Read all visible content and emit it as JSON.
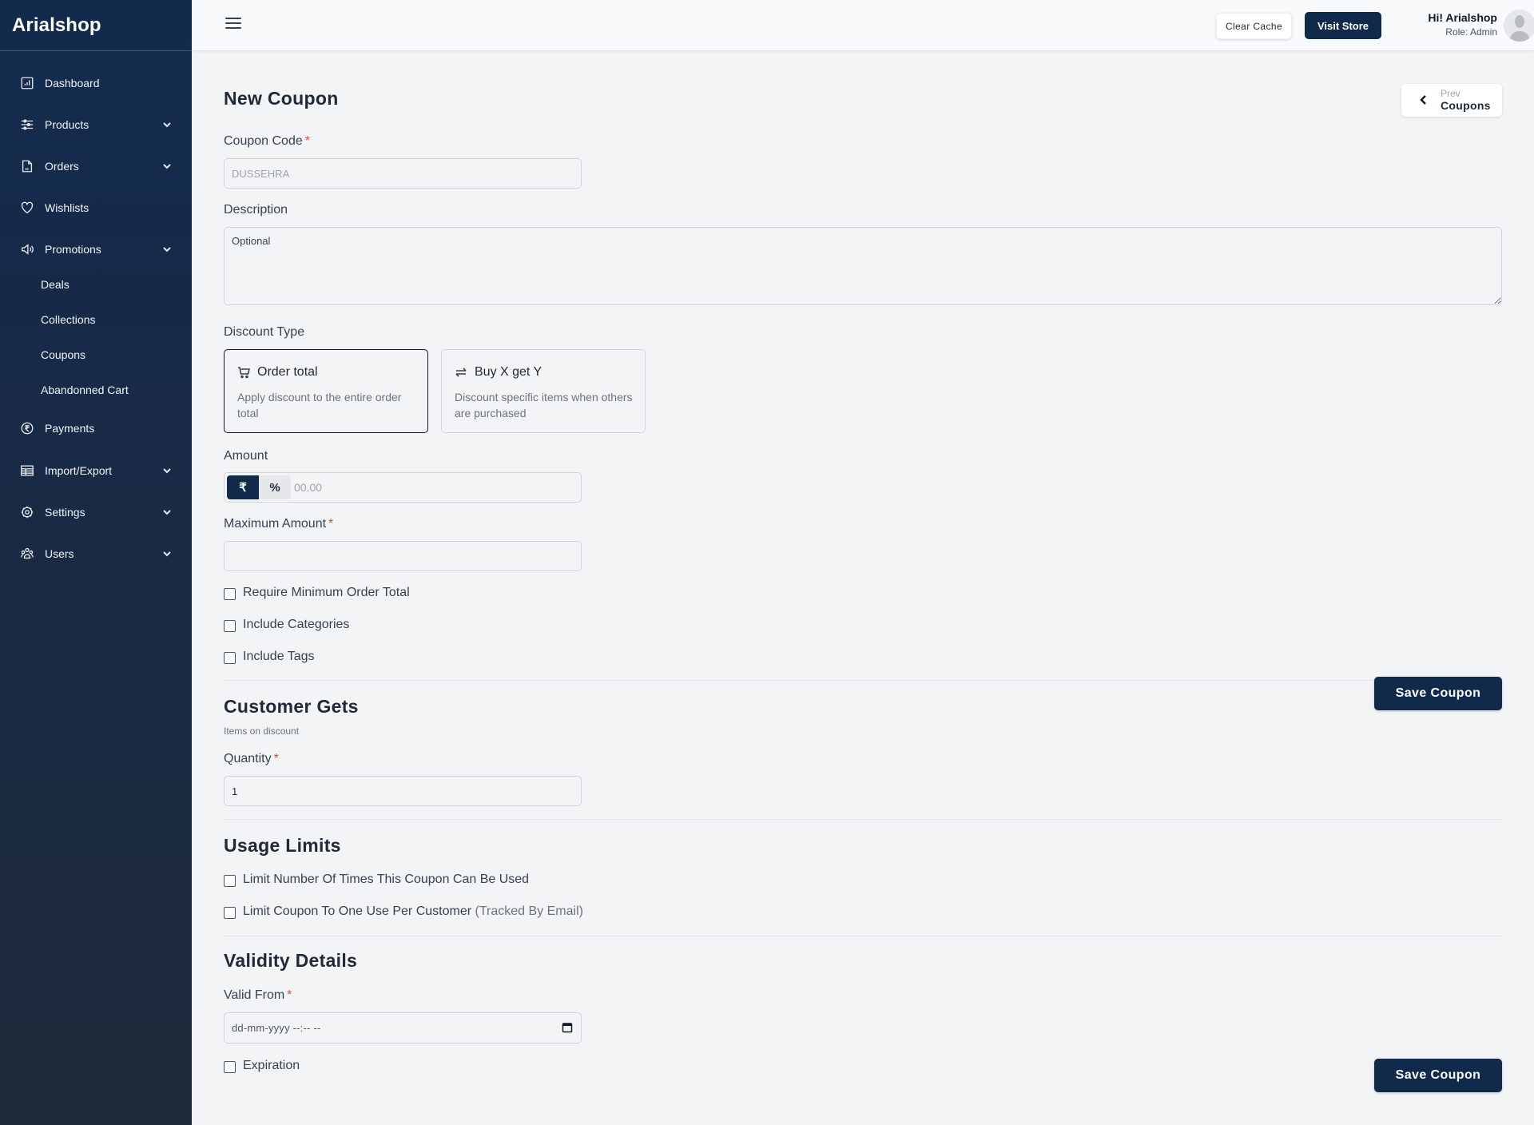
{
  "app": {
    "brand": "Arialshop"
  },
  "sidebar": {
    "items": [
      {
        "label": "Dashboard",
        "icon": "dashboard-chart-icon",
        "expandable": false
      },
      {
        "label": "Products",
        "icon": "sliders-icon",
        "expandable": true
      },
      {
        "label": "Orders",
        "icon": "document-icon",
        "expandable": true
      },
      {
        "label": "Wishlists",
        "icon": "heart-icon",
        "expandable": false
      },
      {
        "label": "Promotions",
        "icon": "megaphone-icon",
        "expandable": true,
        "expanded": true
      },
      {
        "label": "Payments",
        "icon": "rupee-circle-icon",
        "expandable": false
      },
      {
        "label": "Import/Export",
        "icon": "table-icon",
        "expandable": true
      },
      {
        "label": "Settings",
        "icon": "gear-icon",
        "expandable": true
      },
      {
        "label": "Users",
        "icon": "users-icon",
        "expandable": true
      }
    ],
    "promotions_sub": [
      "Deals",
      "Collections",
      "Coupons",
      "Abandonned Cart"
    ]
  },
  "header": {
    "clear_cache": "Clear Cache",
    "visit_store": "Visit Store",
    "greeting": "Hi! Arialshop",
    "role": "Role: Admin"
  },
  "page": {
    "title": "New Coupon",
    "prev_small": "Prev",
    "prev_big": "Coupons"
  },
  "form": {
    "coupon_code": {
      "label": "Coupon Code",
      "required": "*",
      "placeholder": "DUSSEHRA",
      "value": ""
    },
    "description": {
      "label": "Description",
      "placeholder": "Optional",
      "value": ""
    },
    "discount_type": {
      "label": "Discount Type",
      "selected": "order_total",
      "options": [
        {
          "id": "order_total",
          "title": "Order total",
          "desc": "Apply discount to the entire order total",
          "icon": "cart-icon"
        },
        {
          "id": "buy_x_get_y",
          "title": "Buy X get Y",
          "desc": "Discount specific items when others are purchased",
          "icon": "swap-arrows-icon"
        }
      ]
    },
    "amount": {
      "label": "Amount",
      "currency_symbol": "₹",
      "percent_symbol": "%",
      "selected_unit": "currency",
      "placeholder": "00.00",
      "value": ""
    },
    "maximum_amount": {
      "label": "Maximum Amount",
      "required": "*",
      "value": ""
    },
    "checks": [
      {
        "label": "Require Minimum Order Total",
        "checked": false
      },
      {
        "label": "Include Categories",
        "checked": false
      },
      {
        "label": "Include Tags",
        "checked": false
      }
    ],
    "save_label": "Save Coupon"
  },
  "customer_gets": {
    "title": "Customer Gets",
    "subtitle": "Items on discount",
    "quantity": {
      "label": "Quantity",
      "required": "*",
      "value": "1"
    }
  },
  "usage_limits": {
    "title": "Usage Limits",
    "checks": [
      {
        "label": "Limit Number Of Times This Coupon Can Be Used",
        "checked": false
      },
      {
        "label": "Limit Coupon To One Use Per Customer",
        "note": "(Tracked By Email)",
        "checked": false
      }
    ]
  },
  "validity": {
    "title": "Validity Details",
    "valid_from": {
      "label": "Valid From",
      "required": "*",
      "placeholder": "dd-mm-yyyy --:-- --"
    },
    "expiration": {
      "label": "Expiration",
      "checked": false
    }
  },
  "colors": {
    "primary": "#0f2a4a",
    "sidebar_top": "#122b4d",
    "sidebar_bottom": "#1f2a3b",
    "required": "#ef4444",
    "background": "#f3f4f6"
  }
}
